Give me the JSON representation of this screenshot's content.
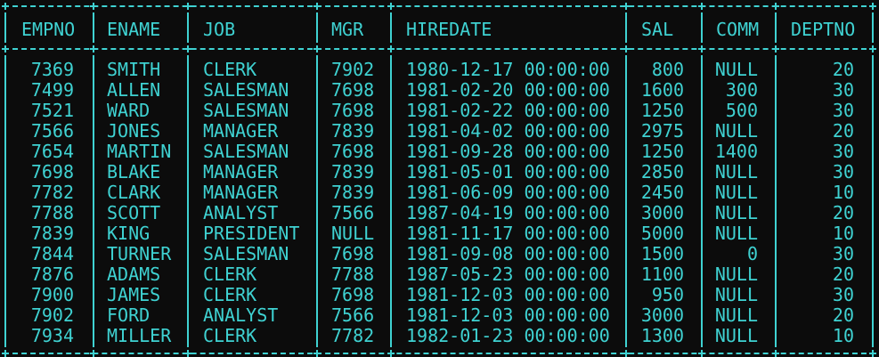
{
  "table": {
    "columns": [
      "EMPNO",
      "ENAME",
      "JOB",
      "MGR",
      "HIREDATE",
      "SAL",
      "COMM",
      "DEPTNO"
    ],
    "rows": [
      [
        "7369",
        "SMITH",
        "CLERK",
        "7902",
        "1980-12-17 00:00:00",
        "800",
        "NULL",
        "20"
      ],
      [
        "7499",
        "ALLEN",
        "SALESMAN",
        "7698",
        "1981-02-20 00:00:00",
        "1600",
        "300",
        "30"
      ],
      [
        "7521",
        "WARD",
        "SALESMAN",
        "7698",
        "1981-02-22 00:00:00",
        "1250",
        "500",
        "30"
      ],
      [
        "7566",
        "JONES",
        "MANAGER",
        "7839",
        "1981-04-02 00:00:00",
        "2975",
        "NULL",
        "20"
      ],
      [
        "7654",
        "MARTIN",
        "SALESMAN",
        "7698",
        "1981-09-28 00:00:00",
        "1250",
        "1400",
        "30"
      ],
      [
        "7698",
        "BLAKE",
        "MANAGER",
        "7839",
        "1981-05-01 00:00:00",
        "2850",
        "NULL",
        "30"
      ],
      [
        "7782",
        "CLARK",
        "MANAGER",
        "7839",
        "1981-06-09 00:00:00",
        "2450",
        "NULL",
        "10"
      ],
      [
        "7788",
        "SCOTT",
        "ANALYST",
        "7566",
        "1987-04-19 00:00:00",
        "3000",
        "NULL",
        "20"
      ],
      [
        "7839",
        "KING",
        "PRESIDENT",
        "NULL",
        "1981-11-17 00:00:00",
        "5000",
        "NULL",
        "10"
      ],
      [
        "7844",
        "TURNER",
        "SALESMAN",
        "7698",
        "1981-09-08 00:00:00",
        "1500",
        "0",
        "30"
      ],
      [
        "7876",
        "ADAMS",
        "CLERK",
        "7788",
        "1987-05-23 00:00:00",
        "1100",
        "NULL",
        "20"
      ],
      [
        "7900",
        "JAMES",
        "CLERK",
        "7698",
        "1981-12-03 00:00:00",
        "950",
        "NULL",
        "30"
      ],
      [
        "7902",
        "FORD",
        "ANALYST",
        "7566",
        "1981-12-03 00:00:00",
        "3000",
        "NULL",
        "20"
      ],
      [
        "7934",
        "MILLER",
        "CLERK",
        "7782",
        "1982-01-23 00:00:00",
        "1300",
        "NULL",
        "10"
      ]
    ]
  },
  "colors": {
    "background": "#0c0c0c",
    "text": "#3fd2d2"
  }
}
